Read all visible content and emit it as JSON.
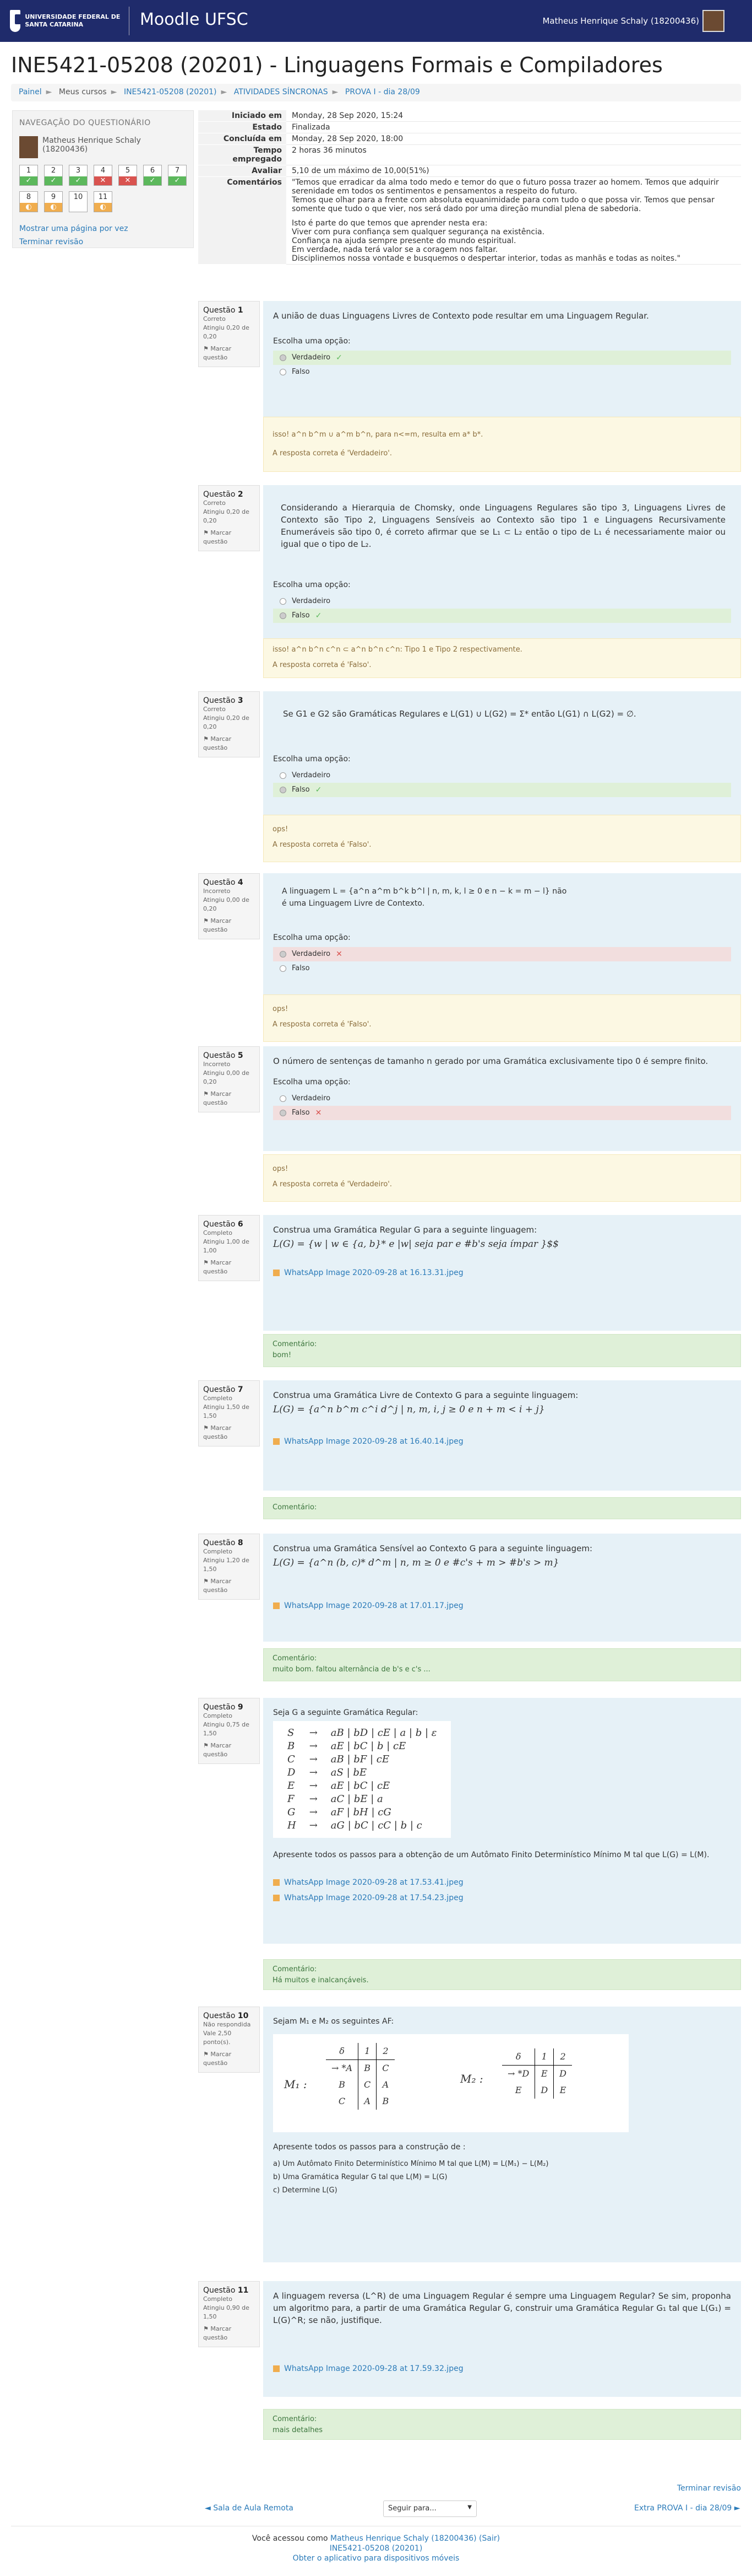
{
  "header": {
    "university": "UNIVERSIDADE FEDERAL DE SANTA CATARINA",
    "site_name": "Moodle UFSC",
    "user_name": "Matheus Henrique Schaly (18200436)"
  },
  "page_title": "INE5421-05208 (20201) - Linguagens Formais e Compiladores",
  "breadcrumbs": [
    "Painel",
    "Meus cursos",
    "INE5421-05208 (20201)",
    "ATIVIDADES SÍNCRONAS",
    "PROVA I - dia 28/09"
  ],
  "quiz_nav": {
    "heading": "NAVEGAÇÃO DO QUESTIONÁRIO",
    "user": "Matheus Henrique Schaly (18200436)",
    "buttons": [
      {
        "n": "1",
        "state": "ok",
        "mark": "✓"
      },
      {
        "n": "2",
        "state": "ok",
        "mark": "✓"
      },
      {
        "n": "3",
        "state": "ok",
        "mark": "✓"
      },
      {
        "n": "4",
        "state": "bad",
        "mark": "✕"
      },
      {
        "n": "5",
        "state": "bad",
        "mark": "✕"
      },
      {
        "n": "6",
        "state": "ok",
        "mark": "✓"
      },
      {
        "n": "7",
        "state": "ok",
        "mark": "✓"
      },
      {
        "n": "8",
        "state": "part",
        "mark": "◐"
      },
      {
        "n": "9",
        "state": "part",
        "mark": "◐"
      },
      {
        "n": "10",
        "state": "none",
        "mark": ""
      },
      {
        "n": "11",
        "state": "part",
        "mark": "◐"
      }
    ],
    "show_one_page": "Mostrar uma página por vez",
    "finish_review": "Terminar revisão"
  },
  "summary": {
    "rows": [
      {
        "label": "Iniciado em",
        "value": "Monday, 28 Sep 2020, 15:24"
      },
      {
        "label": "Estado",
        "value": "Finalizada"
      },
      {
        "label": "Concluída em",
        "value": "Monday, 28 Sep 2020, 18:00"
      },
      {
        "label": "Tempo empregado",
        "value": "2 horas 36 minutos"
      },
      {
        "label": "Avaliar",
        "value": "5,10 de um máximo de 10,00(51%)"
      }
    ],
    "comment_label": "Comentários",
    "comment_lines": [
      "\"Temos que erradicar da alma todo medo e temor do que o futuro possa trazer ao homem. Temos que adquirir serenidade em todos os sentimentos e pensamentos a respeito do futuro.",
      "Temos que olhar para a frente com absoluta equanimidade para com tudo o que possa vir. Temos que pensar somente que tudo o que vier, nos será dado por uma direção mundial plena de sabedoria.",
      "",
      "Isto é parte do que temos que aprender nesta era:",
      "Viver com pura confiança sem qualquer segurança na existência.",
      "Confiança na ajuda sempre presente do mundo espiritual.",
      "Em verdade, nada terá valor se a coragem nos faltar.",
      "Disciplinemos nossa vontade e busquemos o despertar interior, todas as manhãs e todas as noites.\""
    ]
  },
  "common": {
    "flag": "Marcar questão",
    "choose": "Escolha uma opção:",
    "true": "Verdadeiro",
    "false": "Falso",
    "question": "Questão",
    "comment": "Comentário:"
  },
  "questions": [
    {
      "n": "1",
      "status": "Correto",
      "score": "Atingiu 0,20 de 0,20",
      "text": "A união de duas Linguagens Livres de Contexto pode resultar em uma Linguagem Regular.",
      "feedback": "isso! a^n b^m ∪ a^m b^n, para n<=m, resulta em a* b*.",
      "answer": "A resposta correta é 'Verdadeiro'."
    },
    {
      "n": "2",
      "status": "Correto",
      "score": "Atingiu 0,20 de 0,20",
      "text": "Considerando a Hierarquia de Chomsky, onde Linguagens Regulares são tipo 3, Linguagens Livres de Contexto são Tipo 2, Linguagens Sensíveis ao Contexto são tipo 1 e Linguagens Recursivamente Enumeráveis são tipo 0, é correto afirmar que se L₁ ⊂ L₂ então o tipo de L₁ é necessariamente maior ou igual que o tipo de L₂.",
      "feedback": "isso! a^n b^n c^n ⊂ a^n b^n c^n: Tipo 1 e Tipo 2 respectivamente.",
      "answer": "A resposta correta é 'Falso'."
    },
    {
      "n": "3",
      "status": "Correto",
      "score": "Atingiu 0,20 de 0,20",
      "text": "Se G1 e G2 são Gramáticas Regulares e L(G1) ∪ L(G2) = Σ* então L(G1) ∩ L(G2) = ∅.",
      "feedback": "ops!",
      "answer": "A resposta correta é 'Falso'."
    },
    {
      "n": "4",
      "status": "Incorreto",
      "score": "Atingiu 0,00 de 0,20",
      "text1": "A linguagem L = {a^n a^m b^k b^l | n, m, k, l ≥ 0 e n − k = m − l} não",
      "text2": "é uma Linguagem Livre de Contexto.",
      "feedback": "ops!",
      "answer": "A resposta correta é 'Falso'."
    },
    {
      "n": "5",
      "status": "Incorreto",
      "score": "Atingiu 0,00 de 0,20",
      "text": "O número de sentenças de tamanho n gerado por uma Gramática exclusivamente tipo 0 é sempre finito.",
      "feedback": "ops!",
      "answer": "A resposta correta é 'Verdadeiro'."
    },
    {
      "n": "6",
      "status": "Completo",
      "score": "Atingiu 1,00 de 1,00",
      "text": "Construa uma Gramática Regular G para a seguinte linguagem:",
      "formula": "L(G) = {w | w ∈ {a, b}* e |w| seja par e #b's seja ímpar }$$",
      "file": "WhatsApp Image 2020-09-28 at 16.13.31.jpeg",
      "comment": "bom!"
    },
    {
      "n": "7",
      "status": "Completo",
      "score": "Atingiu 1,50 de 1,50",
      "text": "Construa uma Gramática Livre de Contexto G para a seguinte linguagem:",
      "formula": "L(G) = {a^n b^m c^i d^j | n, m, i, j ≥ 0 e n + m < i + j}",
      "file": "WhatsApp Image 2020-09-28 at 16.40.14.jpeg",
      "comment": ""
    },
    {
      "n": "8",
      "status": "Completo",
      "score": "Atingiu 1,20 de 1,50",
      "text": "Construa uma Gramática Sensível ao Contexto G para a seguinte linguagem:",
      "formula": "L(G) = {a^n (b, c)* d^m | n, m ≥ 0 e #c's + m > #b's > m}",
      "file": "WhatsApp Image 2020-09-28 at 17.01.17.jpeg",
      "comment": "muito bom. faltou alternância de b's e c's ..."
    },
    {
      "n": "9",
      "status": "Completo",
      "score": "Atingiu 0,75 de 1,50",
      "text": "Seja G a seguinte Gramática Regular:",
      "grammar": [
        [
          "S",
          "→",
          "aB | bD | cE | a | b | ε"
        ],
        [
          "B",
          "→",
          "aE | bC | b | cE"
        ],
        [
          "C",
          "→",
          "aB | bF | cE"
        ],
        [
          "D",
          "→",
          "aS | bE"
        ],
        [
          "E",
          "→",
          "aE | bC | cE"
        ],
        [
          "F",
          "→",
          "aC | bE | a"
        ],
        [
          "G",
          "→",
          "aF | bH | cG"
        ],
        [
          "H",
          "→",
          "aG | bC | cC | b | c"
        ]
      ],
      "text2": "Apresente todos os passos para a obtenção de um Autômato Finito Determinístico Mínimo M tal que L(G) = L(M).",
      "files": [
        "WhatsApp Image 2020-09-28 at 17.53.41.jpeg",
        "WhatsApp Image 2020-09-28 at 17.54.23.jpeg"
      ],
      "comment": "Há muitos e inalcançáveis."
    },
    {
      "n": "10",
      "status": "Não respondida",
      "score": "Vale 2,50 ponto(s).",
      "text": "Sejam M₁ e M₂ os seguintes AF:",
      "m1": {
        "name": "M₁ :",
        "head": [
          "δ",
          "1",
          "2"
        ],
        "rows": [
          [
            "→ *A",
            "B",
            "C"
          ],
          [
            "B",
            "C",
            "A"
          ],
          [
            "C",
            "A",
            "B"
          ]
        ]
      },
      "m2": {
        "name": "M₂ :",
        "head": [
          "δ",
          "1",
          "2"
        ],
        "rows": [
          [
            "→ *D",
            "E",
            "D"
          ],
          [
            "E",
            "D",
            "E"
          ]
        ]
      },
      "steps_title": "Apresente todos os passos para a construção de :",
      "steps": [
        "a) Um Autômato Finito Determinístico Mínimo M tal que L(M) = L(M₁) − L(M₂)",
        "b) Uma Gramática Regular G tal que L(M) = L(G)",
        "c) Determine L(G)"
      ]
    },
    {
      "n": "11",
      "status": "Completo",
      "score": "Atingiu 0,90 de 1,50",
      "text": "A linguagem reversa (L^R) de uma Linguagem Regular é sempre uma Linguagem Regular? Se sim, proponha um algoritmo para, a partir de uma Gramática Regular G, construir uma Gramática Regular G₁ tal que L(G₁) = L(G)^R; se não, justifique.",
      "file": "WhatsApp Image 2020-09-28 at 17.59.32.jpeg",
      "comment": "mais detalhes"
    }
  ],
  "footer": {
    "finish_review": "Terminar revisão",
    "prev": "◄ Sala de Aula Remota",
    "jump": "Seguir para...",
    "next": "Extra PROVA I - dia 28/09 ►",
    "logged": "Você acessou como",
    "logged_user": "Matheus Henrique Schaly (18200436)",
    "logout": "(Sair)",
    "course": "INE5421-05208 (20201)",
    "app": "Obter o aplicativo para dispositivos móveis"
  }
}
